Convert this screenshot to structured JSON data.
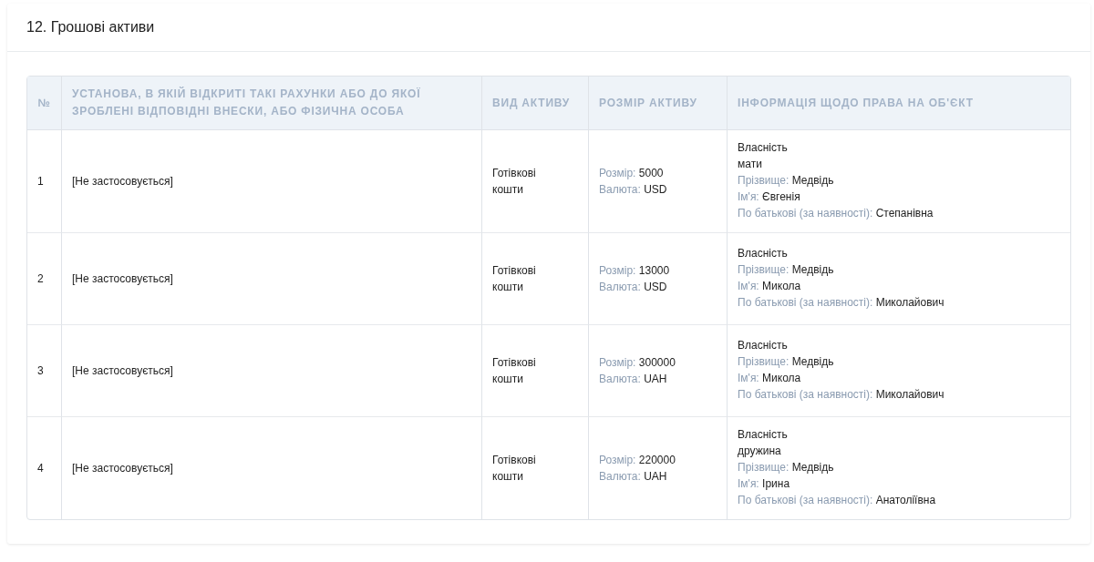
{
  "section": {
    "title": "12. Грошові активи"
  },
  "table": {
    "columns": [
      "№",
      "УСТАНОВА, В ЯКІЙ ВІДКРИТІ ТАКІ РАХУНКИ АБО ДО ЯКОЇ ЗРОБЛЕНІ ВІДПОВІДНІ ВНЕСКИ, АБО ФІЗИЧНА ОСОБА",
      "ВИД АКТИВУ",
      "РОЗМІР АКТИВУ",
      "ІНФОРМАЦІЯ ЩОДО ПРАВА НА ОБ'ЄКТ"
    ],
    "rows": [
      {
        "number": "1",
        "institution": "[Не застосовується]",
        "asset_type": "Готівкові кошти",
        "size": [
          {
            "label": "Розмір:",
            "value": "5000"
          },
          {
            "label": "Валюта:",
            "value": "USD"
          }
        ],
        "rights": {
          "ownership": "Власність",
          "relation": "мати",
          "fields": [
            {
              "label": "Прізвище:",
              "value": "Медвідь"
            },
            {
              "label": "Ім'я:",
              "value": "Євгенія"
            },
            {
              "label": "По батькові (за наявності):",
              "value": "Степанівна"
            }
          ]
        }
      },
      {
        "number": "2",
        "institution": "[Не застосовується]",
        "asset_type": "Готівкові кошти",
        "size": [
          {
            "label": "Розмір:",
            "value": "13000"
          },
          {
            "label": "Валюта:",
            "value": "USD"
          }
        ],
        "rights": {
          "ownership": "Власність",
          "fields": [
            {
              "label": "Прізвище:",
              "value": "Медвідь"
            },
            {
              "label": "Ім'я:",
              "value": "Микола"
            },
            {
              "label": "По батькові (за наявності):",
              "value": "Миколайович"
            }
          ]
        }
      },
      {
        "number": "3",
        "institution": "[Не застосовується]",
        "asset_type": "Готівкові кошти",
        "size": [
          {
            "label": "Розмір:",
            "value": "300000"
          },
          {
            "label": "Валюта:",
            "value": "UAH"
          }
        ],
        "rights": {
          "ownership": "Власність",
          "fields": [
            {
              "label": "Прізвище:",
              "value": "Медвідь"
            },
            {
              "label": "Ім'я:",
              "value": "Микола"
            },
            {
              "label": "По батькові (за наявності):",
              "value": "Миколайович"
            }
          ]
        }
      },
      {
        "number": "4",
        "institution": "[Не застосовується]",
        "asset_type": "Готівкові кошти",
        "size": [
          {
            "label": "Розмір:",
            "value": "220000"
          },
          {
            "label": "Валюта:",
            "value": "UAH"
          }
        ],
        "rights": {
          "ownership": "Власність",
          "relation": "дружина",
          "fields": [
            {
              "label": "Прізвище:",
              "value": "Медвідь"
            },
            {
              "label": "Ім'я:",
              "value": "Ірина"
            },
            {
              "label": "По батькові (за наявності):",
              "value": "Анатоліївна"
            }
          ]
        }
      }
    ]
  }
}
